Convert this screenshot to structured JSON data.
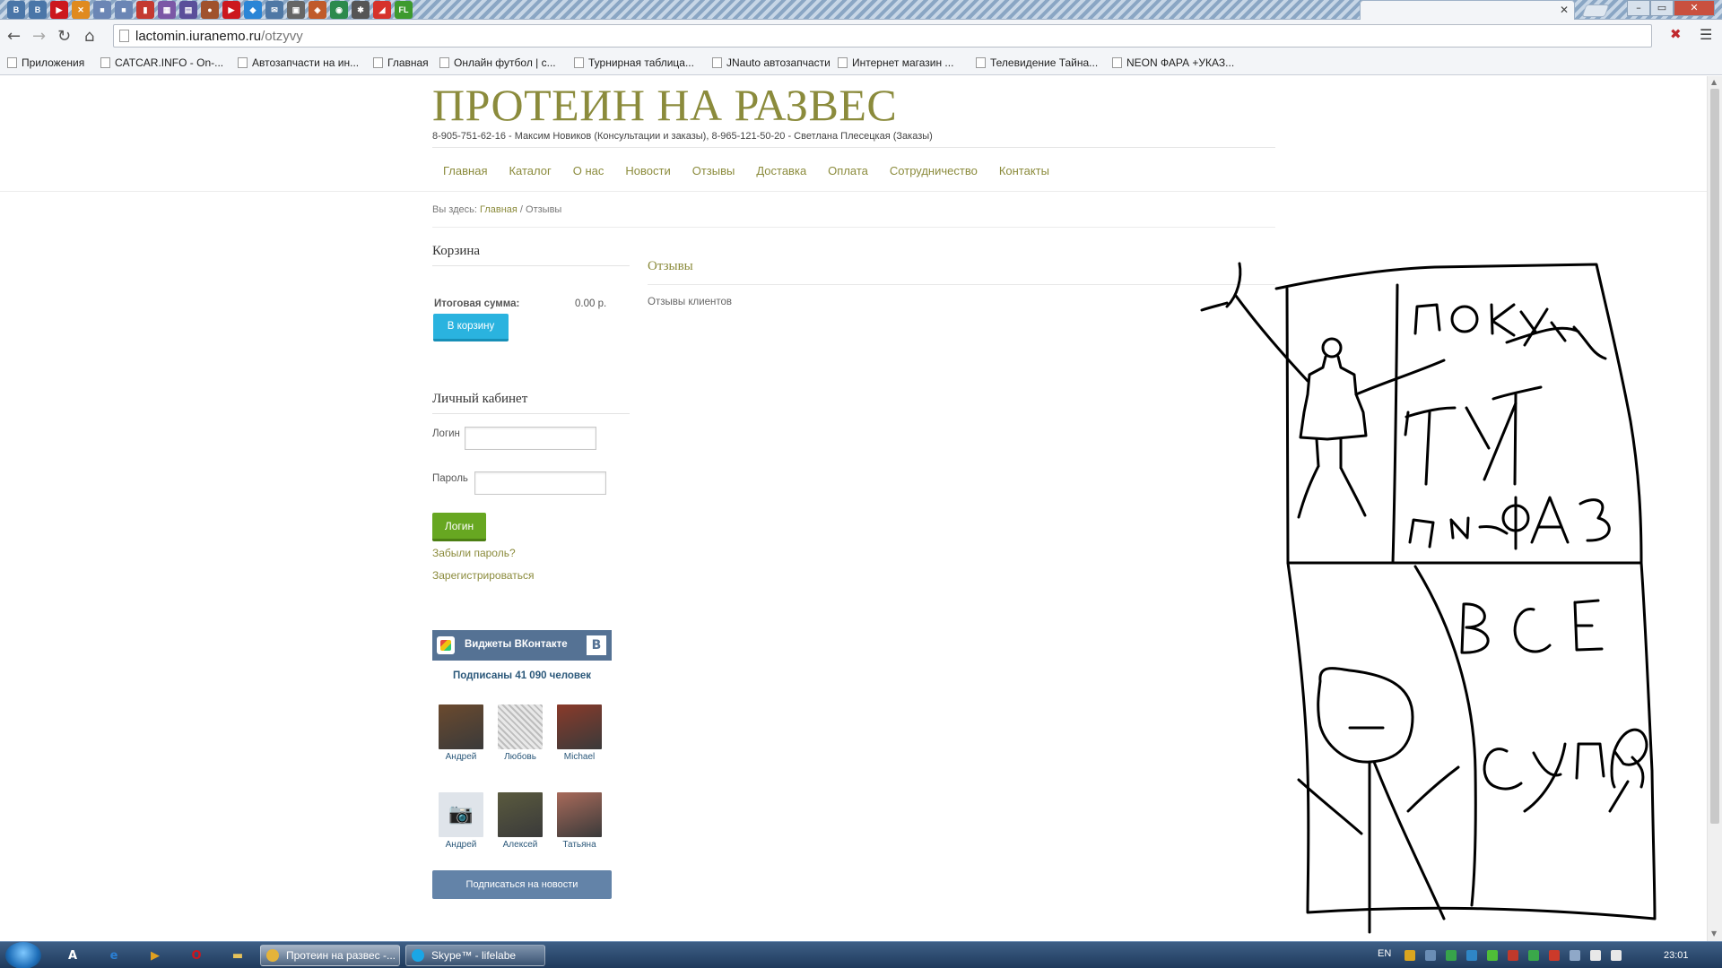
{
  "browser": {
    "pinned_tabs": [
      {
        "icon": "vk-icon",
        "glyph": "B",
        "color": "#4a76a8"
      },
      {
        "icon": "vk-icon",
        "glyph": "B",
        "color": "#4a76a8"
      },
      {
        "icon": "youtube-icon",
        "glyph": "▶",
        "color": "#cc181e"
      },
      {
        "icon": "x-icon",
        "glyph": "✕",
        "color": "#e08a1e"
      },
      {
        "icon": "app-icon",
        "glyph": "■",
        "color": "#6b86b5"
      },
      {
        "icon": "app-icon",
        "glyph": "■",
        "color": "#6b86b5"
      },
      {
        "icon": "stats-icon",
        "glyph": "▮",
        "color": "#c43a31"
      },
      {
        "icon": "chart-icon",
        "glyph": "▦",
        "color": "#7b58a6"
      },
      {
        "icon": "doc-icon",
        "glyph": "▤",
        "color": "#5a4f9a"
      },
      {
        "icon": "game-icon",
        "glyph": "●",
        "color": "#a0522d"
      },
      {
        "icon": "youtube-icon",
        "glyph": "▶",
        "color": "#cc181e"
      },
      {
        "icon": "dropbox-icon",
        "glyph": "◆",
        "color": "#2a85d6"
      },
      {
        "icon": "mail-icon",
        "glyph": "✉",
        "color": "#4f78a5"
      },
      {
        "icon": "page-icon",
        "glyph": "▣",
        "color": "#666666"
      },
      {
        "icon": "shield-icon",
        "glyph": "◈",
        "color": "#c05a2a"
      },
      {
        "icon": "globe-icon",
        "glyph": "◉",
        "color": "#2c8a4d"
      },
      {
        "icon": "puzzle-icon",
        "glyph": "✱",
        "color": "#555555"
      },
      {
        "icon": "brand-icon",
        "glyph": "◢",
        "color": "#d6322b"
      },
      {
        "icon": "fl-icon",
        "glyph": "FL",
        "color": "#3d9a2e"
      }
    ],
    "url_host": "lactomin.iuranemo.ru",
    "url_path": "/otzyvy",
    "bookmarks": [
      {
        "label": "Приложения",
        "icon": "apps-icon"
      },
      {
        "label": "CATCAR.INFO - On-...",
        "icon": "page-icon"
      },
      {
        "label": "Автозапчасти на ин...",
        "icon": "d-icon"
      },
      {
        "label": "Главная",
        "icon": "page-icon"
      },
      {
        "label": "Онлайн футбол | с...",
        "icon": "ball-icon"
      },
      {
        "label": "Турнирная таблица...",
        "icon": "flag-icon"
      },
      {
        "label": "JNauto автозапчасти",
        "icon": "page-icon"
      },
      {
        "label": "Интернет магазин ...",
        "icon": "puzzle-icon"
      },
      {
        "label": "Телевидение Тайна...",
        "icon": "page-icon"
      },
      {
        "label": "NEON ФАРА +УКАЗ...",
        "icon": "page-icon"
      }
    ]
  },
  "site": {
    "title": "ПРОТЕИН НА РАЗВЕС",
    "phones": "8-905-751-62-16 - Максим Новиков (Консультации и заказы), 8-965-121-50-20 - Светлана Плесецкая (Заказы)",
    "nav": [
      "Главная",
      "Каталог",
      "О нас",
      "Новости",
      "Отзывы",
      "Доставка",
      "Оплата",
      "Сотрудничество",
      "Контакты"
    ],
    "breadcrumb": {
      "prefix": "Вы здесь: ",
      "home": "Главная",
      "sep": " / ",
      "current": "Отзывы"
    }
  },
  "cart": {
    "title": "Корзина",
    "total_label": "Итоговая сумма:",
    "total_value": "0.00 р.",
    "button": "В корзину"
  },
  "account": {
    "title": "Личный кабинет",
    "login_label": "Логин",
    "password_label": "Пароль",
    "login_value": "",
    "password_value": "",
    "login_button": "Логин",
    "forgot": "Забыли пароль?",
    "register": "Зарегистрироваться"
  },
  "vk": {
    "title": "Виджеты ВКонтакте",
    "logo": "B",
    "subscribers": "Подписаны 41 090 человек",
    "members": [
      {
        "name": "Андрей",
        "color": "#6b4a2e"
      },
      {
        "name": "Любовь",
        "color": "#cfcfcf"
      },
      {
        "name": "Michael",
        "color": "#8a3a2a"
      },
      {
        "name": "Андрей",
        "color": "#dfe4ea"
      },
      {
        "name": "Алексей",
        "color": "#5a5a3e"
      },
      {
        "name": "Татьяна",
        "color": "#a86a5a"
      }
    ],
    "subscribe_button": "Подписаться на новости"
  },
  "content": {
    "title": "Отзывы",
    "text": "Отзывы клиентов"
  },
  "doodle": {
    "words": [
      "ПОКУПАЙ",
      "ТУТ",
      "ИИ-ФАЗ",
      "ВСЕ",
      "СУПЕР"
    ]
  },
  "taskbar": {
    "quick_launch": [
      {
        "icon": "font-icon",
        "glyph": "A",
        "color": "#111111"
      },
      {
        "icon": "ie-icon",
        "glyph": "e",
        "color": "#2a7fd4"
      },
      {
        "icon": "media-icon",
        "glyph": "▶",
        "color": "#e0a020"
      },
      {
        "icon": "opera-icon",
        "glyph": "O",
        "color": "#d0141c"
      },
      {
        "icon": "folder-icon",
        "glyph": "▬",
        "color": "#e6c25a"
      }
    ],
    "tasks": [
      {
        "label": "Протеин на развес -...",
        "color": "#e4b33a",
        "active": true
      },
      {
        "label": "Skype™ - lifelabe",
        "color": "#1aa6e6",
        "active": false
      }
    ],
    "lang": "EN",
    "clock": "23:01"
  }
}
